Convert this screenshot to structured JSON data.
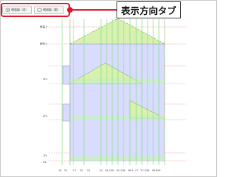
{
  "tabs": [
    {
      "label": "側面図（北）",
      "active": true
    },
    {
      "label": "側面図（東）",
      "active": false
    }
  ],
  "callout": {
    "label": "表示方向タブ"
  },
  "levels": {
    "top": "軒高上",
    "eave": "軒桁上",
    "floor3": "3FL",
    "floor2": "2FL",
    "floor1": "1FL",
    "gl": "GL"
  },
  "x_ticks": [
    "Y0",
    "Y1",
    "Y1",
    "Y2",
    "Y3",
    "Y4",
    "Y4.5",
    "Y5",
    "Y5.5",
    "Y6",
    "Y6.5",
    "Y7",
    "Y7.5",
    "Y8",
    "Y8.5",
    "Y9"
  ],
  "colors": {
    "accent": "#e0142a",
    "wall_fill": "#d9dcff",
    "roof_fill": "#d8f0b0",
    "grid_green": "#7fdc7f",
    "grid_red": "#f08c8c"
  }
}
